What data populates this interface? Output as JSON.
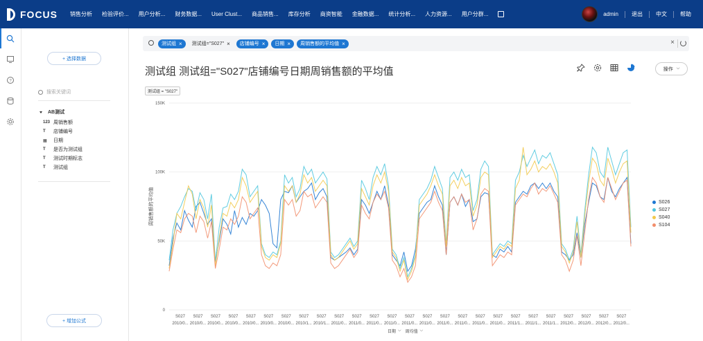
{
  "brand": {
    "name": "FOCUS"
  },
  "nav": [
    "销售分析",
    "检验评价...",
    "用户分析...",
    "财务数据...",
    "User Clust...",
    "商品销售...",
    "库存分析",
    "商资智能",
    "金融数据...",
    "统计分析...",
    "人力资源...",
    "用户分群..."
  ],
  "top_right": {
    "user": "admin",
    "logout": "退出",
    "language": "中文",
    "help": "帮助"
  },
  "left_panel": {
    "select_data_label": "+ 选择数据",
    "search_placeholder": "搜索关键词",
    "root": "AB测试",
    "fields": [
      {
        "type": "123",
        "name": "周销售额"
      },
      {
        "type": "T",
        "name": "店铺编号"
      },
      {
        "type": "date",
        "name": "日期"
      },
      {
        "type": "T",
        "name": "是否为测试组"
      },
      {
        "type": "T",
        "name": "测试时期标志"
      },
      {
        "type": "T",
        "name": "测试组"
      }
    ],
    "add_formula_label": "+ 增加公式"
  },
  "search_tokens": [
    {
      "label": "测试组",
      "style": "blue"
    },
    {
      "label": "测试组=\"S027\"",
      "style": "plain"
    },
    {
      "label": "店铺编号",
      "style": "blue"
    },
    {
      "label": "日期",
      "style": "blue"
    },
    {
      "label": "周销售额的平均值",
      "style": "blue"
    }
  ],
  "page_title": "测试组 测试组=\"S027\"店铺编号日期周销售额的平均值",
  "operation_button": "操作",
  "filter_chip": "测试组 = \"S027\"",
  "accent_color": "#1e77d2",
  "x_footer": {
    "date_label": "日期",
    "period_label": "周均值"
  },
  "chart_data": {
    "type": "line",
    "title": "",
    "xlabel": "日期",
    "ylabel": "周销售额的平均值",
    "ylim": [
      0,
      150000
    ],
    "yticks": [
      "0",
      "50K",
      "100K",
      "150K"
    ],
    "grid": true,
    "legend_position": "right",
    "x_tick_top": [
      "S027",
      "S027",
      "S027",
      "S027",
      "S027",
      "S027",
      "S027",
      "S027",
      "S027",
      "S027",
      "S027",
      "S027",
      "S027",
      "S027",
      "S027",
      "S027",
      "S027",
      "S027",
      "S027",
      "S027",
      "S027",
      "S027",
      "S027",
      "S027",
      "S027",
      "S027"
    ],
    "x_tick_bottom": [
      "2010/0...",
      "2010/0...",
      "2010/0...",
      "2010/0...",
      "2010/0...",
      "2010/0...",
      "2010/0...",
      "2010/1...",
      "2010/1...",
      "2011/0...",
      "2011/0...",
      "2011/0...",
      "2011/0...",
      "2011/0...",
      "2011/0...",
      "2011/0...",
      "2011/0...",
      "2011/0...",
      "2011/0...",
      "2011/1...",
      "2011/1...",
      "2011/1...",
      "2012/0...",
      "2012/0...",
      "2012/0...",
      "2012/0..."
    ],
    "series": [
      {
        "name": "S026",
        "color": "#1e77d2",
        "values": [
          32000,
          52000,
          63000,
          58000,
          72000,
          65000,
          60000,
          75000,
          78000,
          70000,
          62000,
          66000,
          35000,
          50000,
          66000,
          62000,
          55000,
          72000,
          60000,
          67000,
          62000,
          70000,
          68000,
          72000,
          80000,
          76000,
          70000,
          48000,
          45000,
          80000,
          86000,
          85000,
          90000,
          78000,
          82000,
          86000,
          88000,
          92000,
          80000,
          85000,
          88000,
          82000,
          38000,
          36000,
          38000,
          40000,
          42000,
          45000,
          40000,
          44000,
          80000,
          76000,
          70000,
          78000,
          86000,
          80000,
          90000,
          76000,
          40000,
          36000,
          32000,
          42000,
          28000,
          32000,
          44000,
          70000,
          74000,
          78000,
          80000,
          90000,
          82000,
          76000,
          40000,
          78000,
          82000,
          76000,
          84000,
          75000,
          80000,
          64000,
          66000,
          82000,
          85000,
          84000,
          40000,
          38000,
          44000,
          42000,
          46000,
          42000,
          78000,
          82000,
          86000,
          84000,
          90000,
          92000,
          88000,
          92000,
          88000,
          92000,
          86000,
          82000,
          42000,
          40000,
          36000,
          40000,
          56000,
          38000,
          62000,
          78000,
          92000,
          90000,
          82000,
          80000,
          96000,
          86000,
          82000,
          88000,
          92000,
          96000,
          48000
        ]
      },
      {
        "name": "S027",
        "color": "#4fc6de",
        "values": [
          36000,
          58000,
          70000,
          75000,
          82000,
          88000,
          86000,
          72000,
          85000,
          80000,
          66000,
          84000,
          35000,
          60000,
          74000,
          75000,
          84000,
          80000,
          86000,
          102000,
          98000,
          82000,
          86000,
          90000,
          48000,
          40000,
          38000,
          42000,
          40000,
          50000,
          98000,
          92000,
          96000,
          82000,
          88000,
          104000,
          98000,
          102000,
          92000,
          96000,
          100000,
          95000,
          42000,
          38000,
          40000,
          44000,
          48000,
          52000,
          46000,
          50000,
          94000,
          88000,
          80000,
          96000,
          104000,
          98000,
          106000,
          90000,
          44000,
          40000,
          30000,
          38000,
          24000,
          30000,
          40000,
          80000,
          84000,
          88000,
          94000,
          104000,
          96000,
          88000,
          48000,
          96000,
          100000,
          94000,
          102000,
          96000,
          98000,
          72000,
          80000,
          102000,
          108000,
          104000,
          40000,
          44000,
          48000,
          46000,
          50000,
          48000,
          94000,
          100000,
          112000,
          104000,
          110000,
          116000,
          106000,
          112000,
          110000,
          114000,
          106000,
          98000,
          48000,
          44000,
          36000,
          44000,
          68000,
          40000,
          72000,
          98000,
          118000,
          114000,
          100000,
          96000,
          118000,
          108000,
          98000,
          106000,
          114000,
          116000,
          60000
        ]
      },
      {
        "name": "S040",
        "color": "#f2c94c",
        "values": [
          30000,
          48000,
          70000,
          66000,
          78000,
          90000,
          84000,
          66000,
          80000,
          74000,
          60000,
          76000,
          32000,
          52000,
          70000,
          68000,
          78000,
          74000,
          80000,
          96000,
          90000,
          78000,
          82000,
          86000,
          46000,
          38000,
          36000,
          40000,
          38000,
          48000,
          90000,
          86000,
          90000,
          78000,
          84000,
          98000,
          92000,
          96000,
          86000,
          90000,
          94000,
          90000,
          40000,
          36000,
          38000,
          42000,
          46000,
          50000,
          44000,
          48000,
          88000,
          82000,
          76000,
          90000,
          98000,
          92000,
          100000,
          86000,
          42000,
          38000,
          28000,
          36000,
          22000,
          28000,
          38000,
          76000,
          80000,
          84000,
          90000,
          98000,
          90000,
          84000,
          46000,
          90000,
          94000,
          88000,
          96000,
          90000,
          92000,
          68000,
          76000,
          96000,
          100000,
          98000,
          38000,
          42000,
          46000,
          44000,
          48000,
          46000,
          88000,
          94000,
          118000,
          98000,
          102000,
          108000,
          100000,
          104000,
          102000,
          106000,
          100000,
          92000,
          46000,
          42000,
          34000,
          42000,
          64000,
          38000,
          68000,
          92000,
          110000,
          106000,
          94000,
          90000,
          110000,
          102000,
          92000,
          100000,
          106000,
          108000,
          56000
        ]
      },
      {
        "name": "S104",
        "color": "#f28e6c",
        "values": [
          28000,
          44000,
          58000,
          56000,
          66000,
          70000,
          68000,
          56000,
          68000,
          64000,
          52000,
          64000,
          30000,
          44000,
          60000,
          58000,
          66000,
          62000,
          68000,
          82000,
          78000,
          66000,
          70000,
          74000,
          40000,
          32000,
          30000,
          34000,
          32000,
          40000,
          80000,
          76000,
          80000,
          68000,
          72000,
          86000,
          82000,
          84000,
          74000,
          78000,
          82000,
          78000,
          34000,
          30000,
          32000,
          36000,
          40000,
          44000,
          38000,
          42000,
          76000,
          70000,
          66000,
          78000,
          84000,
          80000,
          86000,
          74000,
          36000,
          32000,
          24000,
          30000,
          20000,
          24000,
          32000,
          66000,
          70000,
          74000,
          78000,
          86000,
          78000,
          72000,
          40000,
          78000,
          82000,
          76000,
          84000,
          78000,
          80000,
          58000,
          66000,
          84000,
          88000,
          86000,
          32000,
          36000,
          40000,
          38000,
          42000,
          40000,
          76000,
          80000,
          84000,
          82000,
          88000,
          92000,
          84000,
          88000,
          86000,
          90000,
          84000,
          78000,
          40000,
          36000,
          28000,
          36000,
          54000,
          32000,
          56000,
          80000,
          96000,
          92000,
          82000,
          78000,
          96000,
          88000,
          80000,
          86000,
          92000,
          94000,
          46000
        ]
      }
    ]
  }
}
